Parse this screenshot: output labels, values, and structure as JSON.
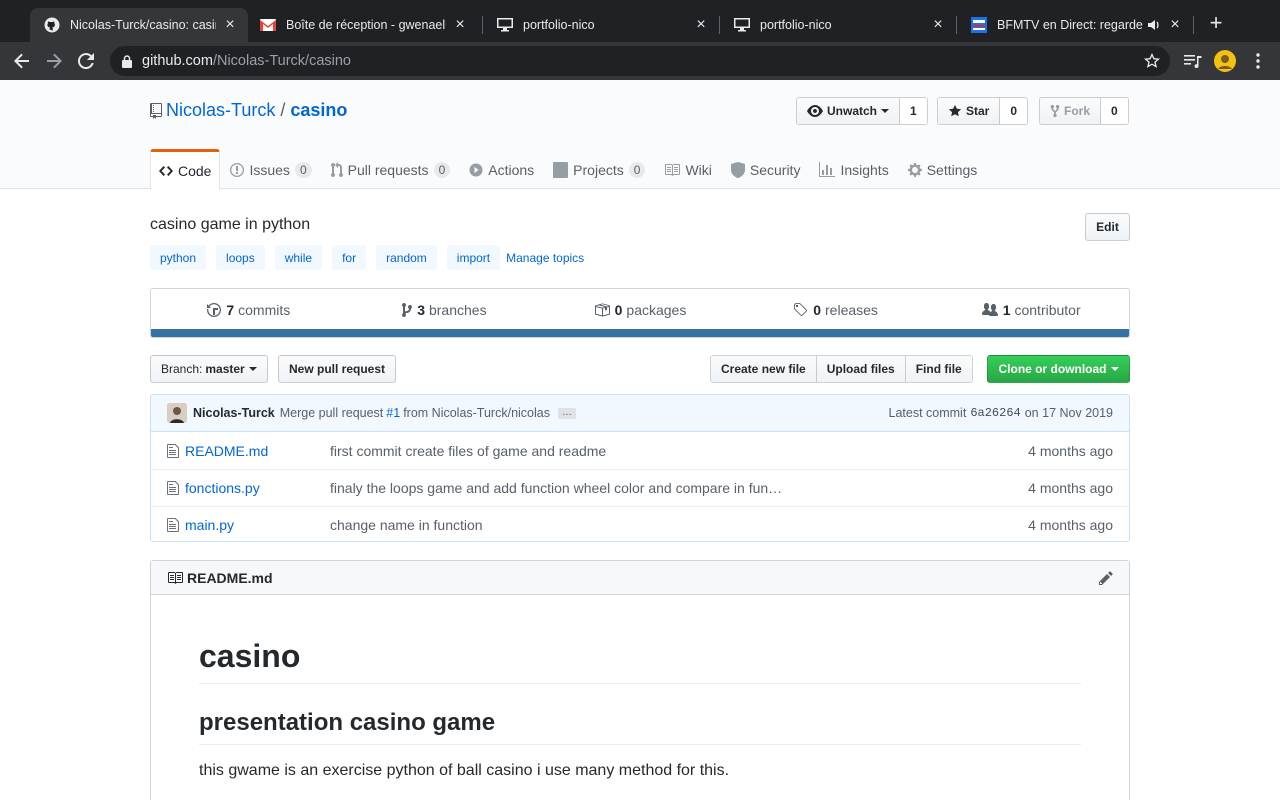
{
  "browser": {
    "tabs": [
      {
        "title": "Nicolas-Turck/casino: casino game in python",
        "icon": "github-icon"
      },
      {
        "title": "Boîte de réception - gwenaelle",
        "icon": "gmail-icon"
      },
      {
        "title": "portfolio-nico",
        "icon": "monitor-icon"
      },
      {
        "title": "portfolio-nico",
        "icon": "monitor-icon"
      },
      {
        "title": "BFMTV en Direct: regarder",
        "icon": "bfmtv-icon"
      }
    ],
    "url_host": "github.com",
    "url_path": "/Nicolas-Turck/casino"
  },
  "repo": {
    "owner": "Nicolas-Turck",
    "separator": "/",
    "name": "casino",
    "watch_label": "Unwatch",
    "watch_count": "1",
    "star_label": "Star",
    "star_count": "0",
    "fork_label": "Fork",
    "fork_count": "0"
  },
  "nav": {
    "tabs": [
      {
        "label": "Code",
        "counter": null
      },
      {
        "label": "Issues",
        "counter": "0"
      },
      {
        "label": "Pull requests",
        "counter": "0"
      },
      {
        "label": "Actions",
        "counter": null
      },
      {
        "label": "Projects",
        "counter": "0"
      },
      {
        "label": "Wiki",
        "counter": null
      },
      {
        "label": "Security",
        "counter": null
      },
      {
        "label": "Insights",
        "counter": null
      },
      {
        "label": "Settings",
        "counter": null
      }
    ]
  },
  "about": {
    "description": "casino game in python",
    "edit_label": "Edit",
    "topics": [
      "python",
      "loops",
      "while",
      "for",
      "random",
      "import"
    ],
    "manage_topics": "Manage topics"
  },
  "summary": {
    "commits_count": "7",
    "commits_label": "commits",
    "branches_count": "3",
    "branches_label": "branches",
    "packages_count": "0",
    "packages_label": "packages",
    "releases_count": "0",
    "releases_label": "releases",
    "contributors_count": "1",
    "contributors_label": "contributor",
    "language_color": "#3572A5"
  },
  "filenav": {
    "branch_prefix": "Branch:",
    "branch_name": "master",
    "new_pr": "New pull request",
    "create_file": "Create new file",
    "upload_files": "Upload files",
    "find_file": "Find file",
    "clone": "Clone or download"
  },
  "commit": {
    "author": "Nicolas-Turck",
    "message_prefix": "Merge pull request",
    "pr": "#1",
    "message_suffix": "from Nicolas-Turck/nicolas",
    "ellipsis": "…",
    "latest_label": "Latest commit",
    "sha": "6a26264",
    "date": "on 17 Nov 2019"
  },
  "files": [
    {
      "name": "README.md",
      "message": "first commit create files of game and readme",
      "age": "4 months ago"
    },
    {
      "name": "fonctions.py",
      "message": "finaly the loops game and add function wheel color and compare in fun…",
      "age": "4 months ago"
    },
    {
      "name": "main.py",
      "message": "change name in function",
      "age": "4 months ago"
    }
  ],
  "readme": {
    "filename": "README.md",
    "h1": "casino",
    "h2": "presentation casino game",
    "paragraph": "this gwame is an exercise python of ball casino i use many method for this."
  }
}
